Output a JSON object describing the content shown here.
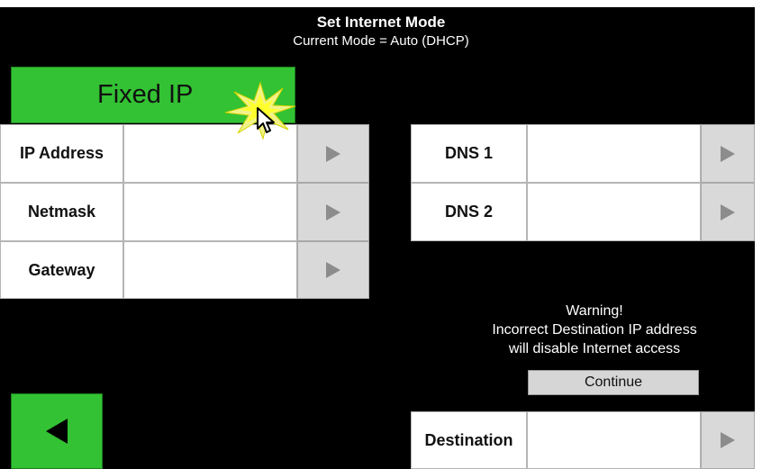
{
  "header": {
    "title": "Set Internet Mode",
    "current_mode": "Current Mode = Auto (DHCP)"
  },
  "mode_button": {
    "label": "Fixed IP"
  },
  "left_fields": [
    {
      "label": "IP Address",
      "value": ""
    },
    {
      "label": "Netmask",
      "value": ""
    },
    {
      "label": "Gateway",
      "value": ""
    }
  ],
  "right_fields": [
    {
      "label": "DNS 1",
      "value": ""
    },
    {
      "label": "DNS 2",
      "value": ""
    }
  ],
  "warning": {
    "line1": "Warning!",
    "line2": "Incorrect Destination IP address",
    "line3": "will disable Internet access",
    "continue_label": "Continue"
  },
  "destination": {
    "label": "Destination",
    "value": ""
  },
  "icons": {
    "back": "back-arrow-icon",
    "edit": "right-arrow-icon",
    "click_burst": "click-burst-icon",
    "cursor": "mouse-cursor-icon"
  },
  "colors": {
    "background": "#000000",
    "mode_button": "#33c233",
    "field": "#ffffff",
    "arrow_button": "#d9d9d9"
  }
}
